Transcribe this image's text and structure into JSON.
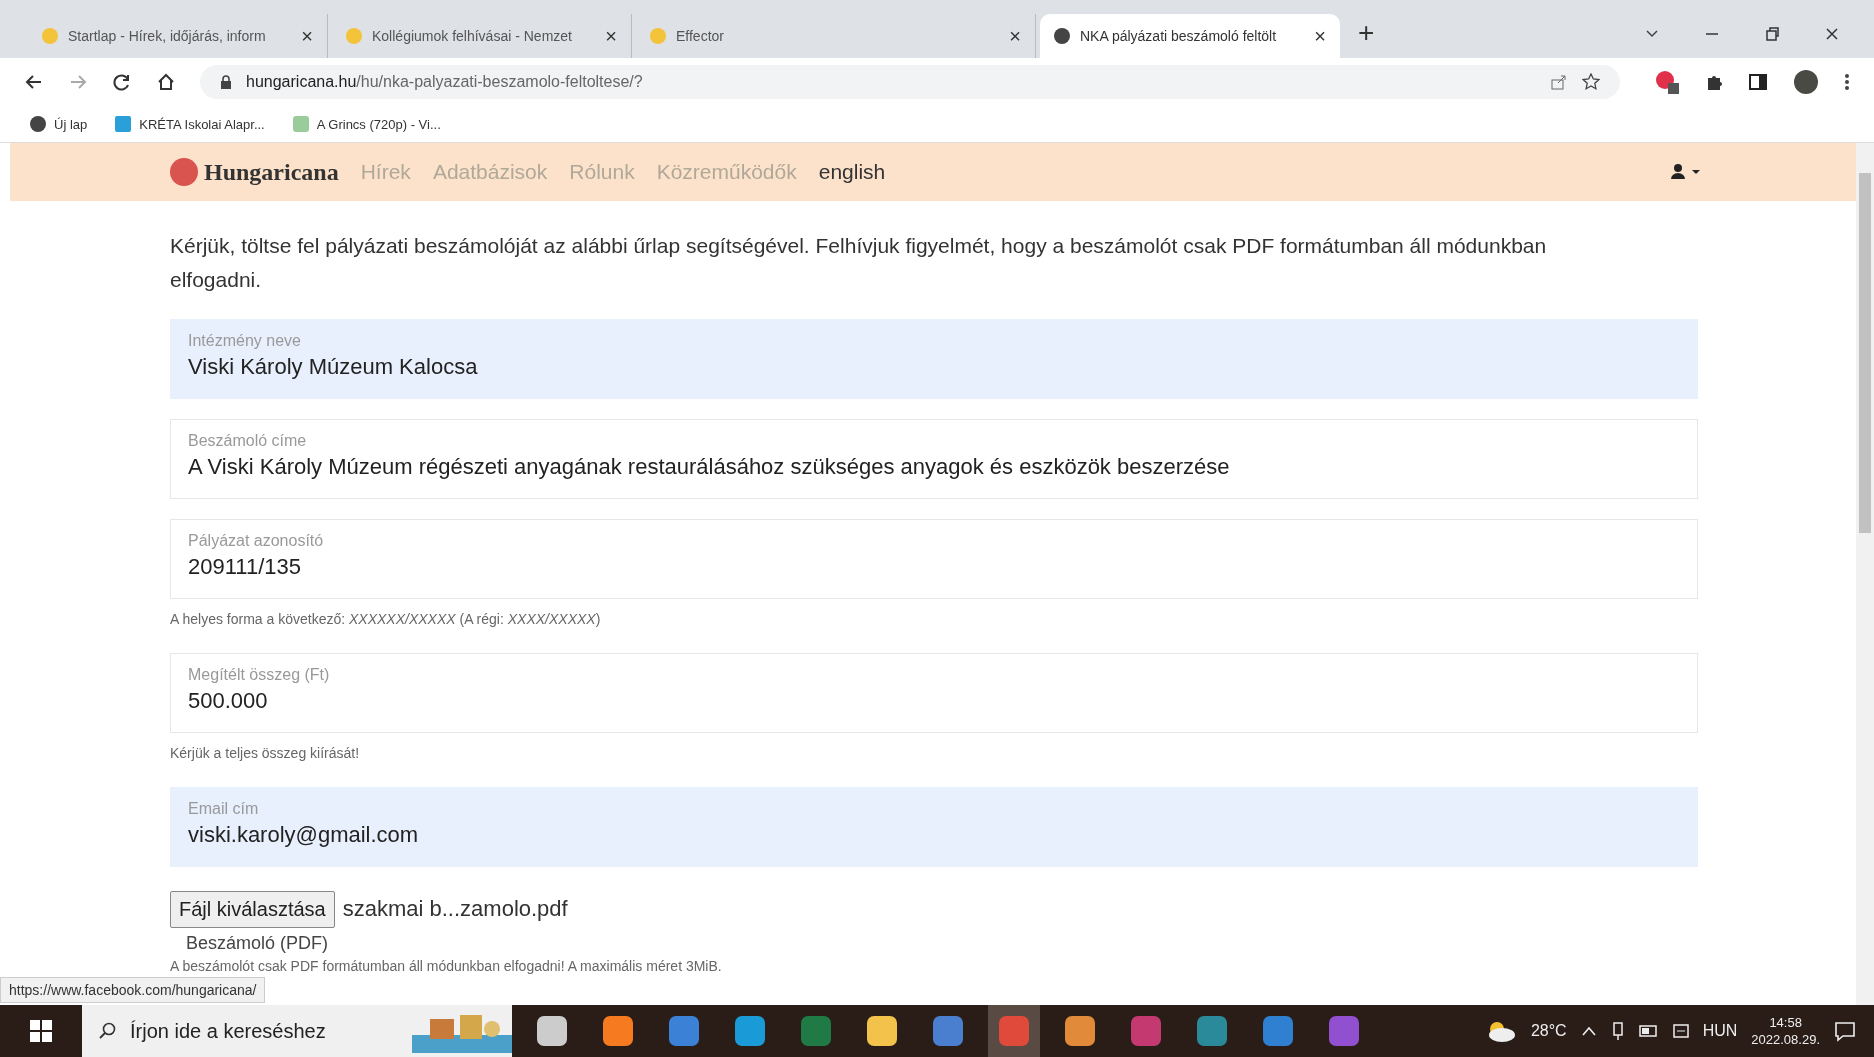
{
  "browser": {
    "tabs": [
      {
        "title": "Startlap - Hírek, időjárás, inform",
        "selected": false,
        "close": "×"
      },
      {
        "title": "Kollégiumok felhívásai - Nemzet",
        "selected": false,
        "close": "×"
      },
      {
        "title": "Effector",
        "selected": false,
        "close": "×"
      },
      {
        "title": "NKA pályázati beszámoló feltölt",
        "selected": true,
        "close": "×"
      }
    ],
    "new_tab": "+",
    "address": {
      "domain": "hungaricana.hu",
      "path": "/hu/nka-palyazati-beszamolo-feltoltese/?"
    },
    "bookmarks": [
      {
        "label": "Új lap"
      },
      {
        "label": "KRÉTA Iskolai Alapr..."
      },
      {
        "label": "A Grincs (720p) - Vi..."
      }
    ]
  },
  "site": {
    "logo": "Hungaricana",
    "nav": [
      {
        "label": "Hírek",
        "selected": false
      },
      {
        "label": "Adatbázisok",
        "selected": false
      },
      {
        "label": "Rólunk",
        "selected": false
      },
      {
        "label": "Közreműködők",
        "selected": false
      },
      {
        "label": "english",
        "selected": true
      }
    ]
  },
  "intro": "Kérjük, töltse fel pályázati beszámolóját az alábbi űrlap segítségével. Felhívjuk figyelmét, hogy a beszámolót csak PDF formátumban áll módunkban elfogadni.",
  "fields": [
    {
      "label": "Intézmény neve",
      "value": "Viski Károly Múzeum Kalocsa",
      "autofilled": true
    },
    {
      "label": "Beszámoló címe",
      "value": "A Viski Károly Múzeum régészeti anyagának restaurálásához szükséges anyagok és eszközök beszerzése",
      "autofilled": false
    },
    {
      "label": "Pályázat azonosító",
      "value": "209111/135",
      "autofilled": false,
      "hint": "A helyes forma a következő: *XXXXXX/XXXXX* (A régi: *XXXX/XXXXX*)"
    },
    {
      "label": "Megítélt összeg (Ft)",
      "value": "500.000",
      "autofilled": false,
      "hint": "Kérjük a teljes összeg kiírását!"
    },
    {
      "label": "Email cím",
      "value": "viski.karoly@gmail.com",
      "autofilled": true
    }
  ],
  "file": {
    "button": "Fájl kiválasztása",
    "filename": "szakmai b...zamolo.pdf",
    "label": "Beszámoló (PDF)",
    "hint": "A beszámolót csak PDF formátumban áll módunkban elfogadni! A maximális méret 3MiB."
  },
  "status_url": "https://www.facebook.com/hungaricana/",
  "taskbar": {
    "search": "Írjon ide a kereséshez",
    "apps": [
      {
        "kind": "taskview",
        "selected": false
      },
      {
        "kind": "firefox",
        "selected": false
      },
      {
        "kind": "store",
        "selected": false
      },
      {
        "kind": "edge",
        "selected": false
      },
      {
        "kind": "excel",
        "selected": false
      },
      {
        "kind": "folder",
        "selected": false
      },
      {
        "kind": "doc",
        "selected": false
      },
      {
        "kind": "chrome",
        "selected": true
      },
      {
        "kind": "media",
        "selected": false
      },
      {
        "kind": "floppy",
        "selected": false
      },
      {
        "kind": "globe",
        "selected": false
      },
      {
        "kind": "mail",
        "selected": false
      },
      {
        "kind": "drop",
        "selected": false
      }
    ],
    "temperature": "28°C",
    "language": "HUN",
    "time": "14:58",
    "date": "2022.08.29."
  }
}
